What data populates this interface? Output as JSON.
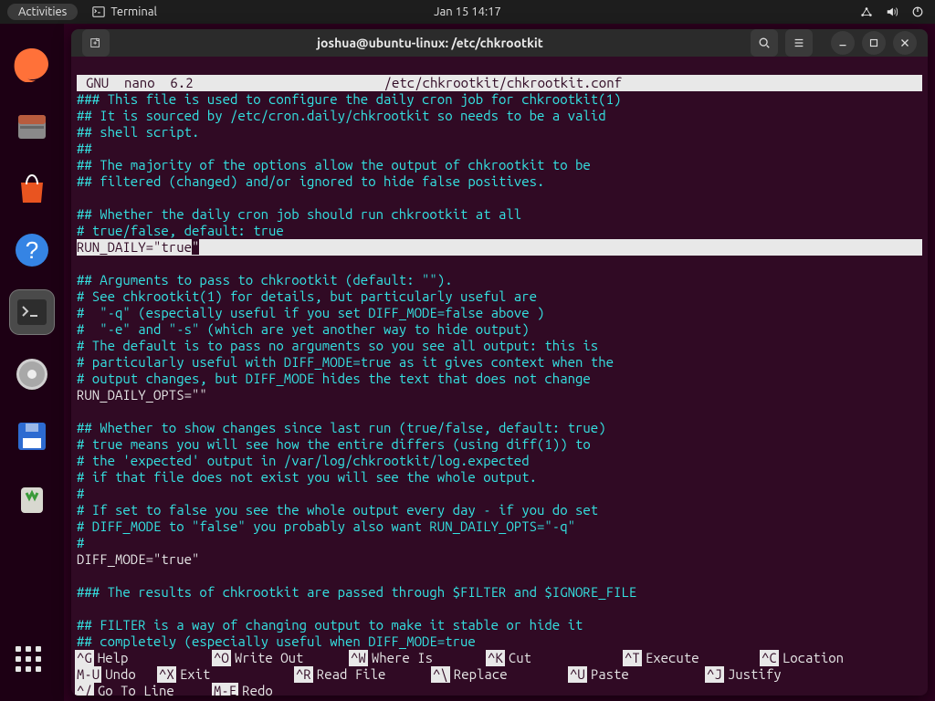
{
  "topbar": {
    "activities": "Activities",
    "app_label": "Terminal",
    "clock": "Jan 15  14:17"
  },
  "title": "joshua@ubuntu-linux: /etc/chkrootkit",
  "nano": {
    "version": "GNU  nano  6.2",
    "filepath": "/etc/chkrootkit/chkrootkit.conf"
  },
  "lines": {
    "l1": "### This file is used to configure the daily cron job for chkrootkit(1)",
    "l2": "## It is sourced by /etc/cron.daily/chkrootkit so needs to be a valid",
    "l3": "## shell script.",
    "l4": "##",
    "l5": "## The majority of the options allow the output of chkrootkit to be",
    "l6": "## filtered (changed) and/or ignored to hide false positives.",
    "l7": "",
    "l8": "## Whether the daily cron job should run chkrootkit at all",
    "l9": "# true/false, default: true",
    "l10a": "RUN_DAILY=\"true",
    "l10b": "\"",
    "l11": "",
    "l12": "## Arguments to pass to chkrootkit (default: \"\").",
    "l13": "# See chkrootkit(1) for details, but particularly useful are",
    "l14": "#  \"-q\" (especially useful if you set DIFF_MODE=false above )",
    "l15": "#  \"-e\" and \"-s\" (which are yet another way to hide output)",
    "l16": "# The default is to pass no arguments so you see all output: this is",
    "l17": "# particularly useful with DIFF_MODE=true as it gives context when the",
    "l18": "# output changes, but DIFF_MODE hides the text that does not change",
    "l19": "RUN_DAILY_OPTS=\"\"",
    "l20": "",
    "l21": "## Whether to show changes since last run (true/false, default: true)",
    "l22": "# true means you will see how the entire differs (using diff(1)) to",
    "l23": "# the 'expected' output in /var/log/chkrootkit/log.expected",
    "l24": "# if that file does not exist you will see the whole output.",
    "l25": "#",
    "l26": "# If set to false you see the whole output every day - if you do set",
    "l27": "# DIFF_MODE to \"false\" you probably also want RUN_DAILY_OPTS=\"-q\"",
    "l28": "#",
    "l29": "DIFF_MODE=\"true\"",
    "l30": "",
    "l31": "### The results of chkrootkit are passed through $FILTER and $IGNORE_FILE",
    "l32": "",
    "l33": "## FILTER is a way of changing output to make it stable or hide it",
    "l34": "## completely (especially useful when DIFF_MODE=true"
  },
  "shortcuts": {
    "g": {
      "k": "^G",
      "t": "Help"
    },
    "o": {
      "k": "^O",
      "t": "Write Out"
    },
    "w": {
      "k": "^W",
      "t": "Where Is"
    },
    "k": {
      "k": "^K",
      "t": "Cut"
    },
    "t": {
      "k": "^T",
      "t": "Execute"
    },
    "c": {
      "k": "^C",
      "t": "Location"
    },
    "mu": {
      "k": "M-U",
      "t": "Undo"
    },
    "x": {
      "k": "^X",
      "t": "Exit"
    },
    "r": {
      "k": "^R",
      "t": "Read File"
    },
    "bs": {
      "k": "^\\",
      "t": "Replace"
    },
    "u": {
      "k": "^U",
      "t": "Paste"
    },
    "j": {
      "k": "^J",
      "t": "Justify"
    },
    "sl": {
      "k": "^/",
      "t": "Go To Line"
    },
    "me": {
      "k": "M-E",
      "t": "Redo"
    }
  }
}
